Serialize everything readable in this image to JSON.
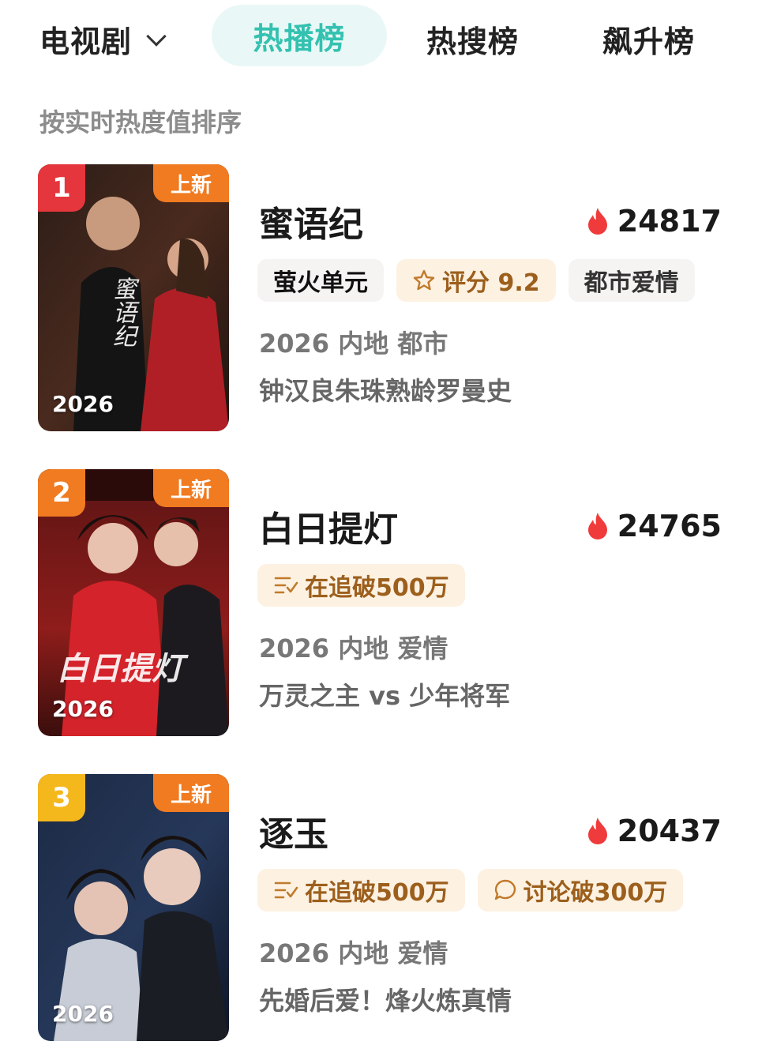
{
  "topbar": {
    "category": "电视剧",
    "tabs": [
      {
        "label": "热播榜",
        "active": true
      },
      {
        "label": "热搜榜",
        "active": false
      },
      {
        "label": "飙升榜",
        "active": false
      }
    ],
    "accent_color": "#34c1b0"
  },
  "subtitle": "按实时热度值排序",
  "items": [
    {
      "rank": "1",
      "rank_color": "#e5363d",
      "badge": "上新",
      "year": "2026",
      "poster_title": "蜜语纪",
      "title": "蜜语纪",
      "heat": "24817",
      "tag_brand": "萤火单元",
      "tag_rating": "评分 9.2",
      "tag_genre": "都市爱情",
      "meta": "2026 内地 都市",
      "desc": "钟汉良朱珠熟龄罗曼史"
    },
    {
      "rank": "2",
      "rank_color": "#f07b21",
      "badge": "上新",
      "year": "2026",
      "poster_title": "白日提灯",
      "title": "白日提灯",
      "heat": "24765",
      "tag_follow": "在追破500万",
      "meta": "2026 内地 爱情",
      "desc": "万灵之主 vs 少年将军"
    },
    {
      "rank": "3",
      "rank_color": "#f5b81c",
      "badge": "上新",
      "year": "2026",
      "poster_title": "逐玉",
      "title": "逐玉",
      "heat": "20437",
      "tag_follow": "在追破500万",
      "tag_discuss": "讨论破300万",
      "meta": "2026 内地 爱情",
      "desc": "先婚后爱！烽火炼真情"
    }
  ],
  "icons": {
    "flame": "flame-icon",
    "star": "star-icon",
    "follow": "follow-list-icon",
    "chat": "chat-bubble-icon",
    "chevron": "chevron-down-icon"
  }
}
